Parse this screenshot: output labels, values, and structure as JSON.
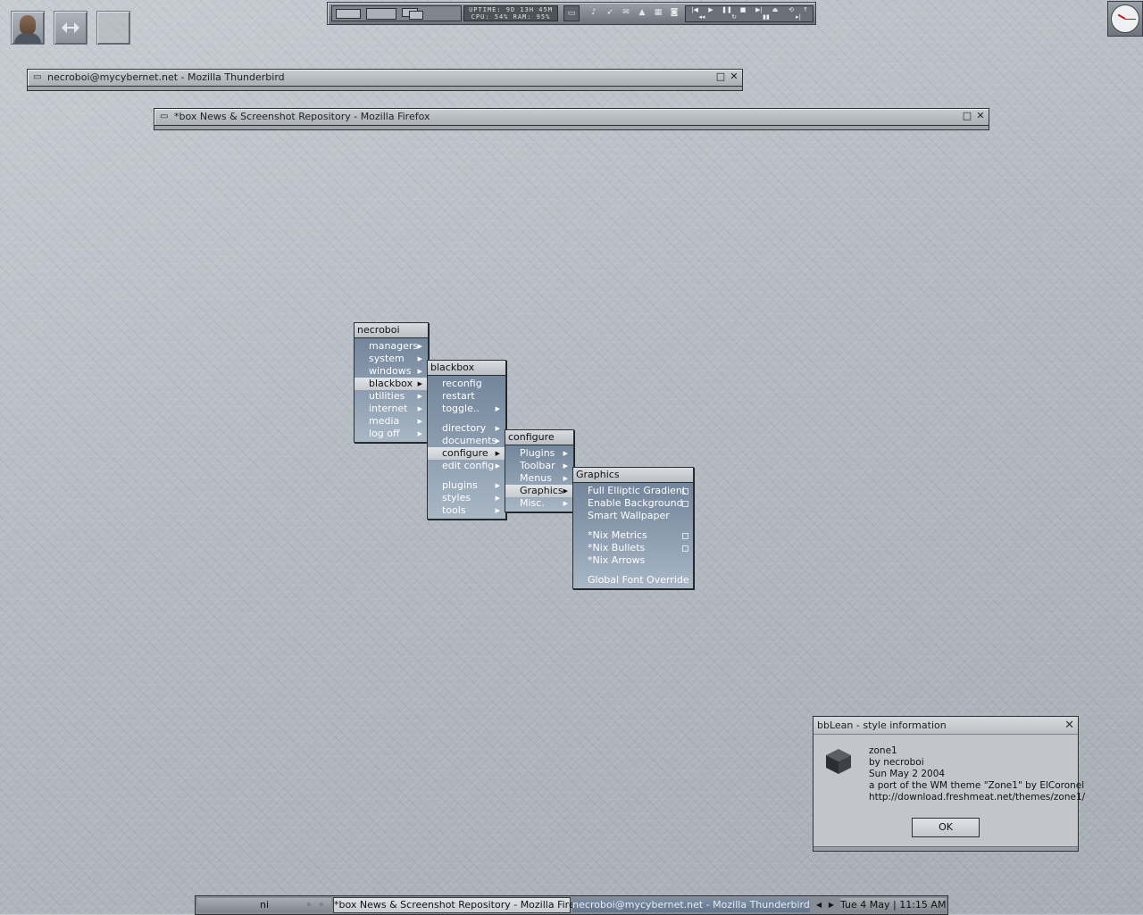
{
  "windows": {
    "thunderbird": {
      "title": "necroboi@mycybernet.net - Mozilla Thunderbird"
    },
    "firefox": {
      "title": "*box News & Screenshot Repository - Mozilla Firefox"
    }
  },
  "toolbar": {
    "sysinfo_line1": "UPTIME: 9D 13H 45M",
    "sysinfo_line2": "CPU: 54% RAM: 95%"
  },
  "menus": {
    "root": {
      "title": "necroboi",
      "items": [
        {
          "label": "managers"
        },
        {
          "label": "system"
        },
        {
          "label": "windows"
        },
        {
          "label": "blackbox"
        },
        {
          "label": "utilities"
        },
        {
          "label": "internet"
        },
        {
          "label": "media"
        },
        {
          "label": "log off"
        }
      ]
    },
    "blackbox": {
      "title": "blackbox",
      "items": [
        {
          "label": "reconfig"
        },
        {
          "label": "restart"
        },
        {
          "label": "toggle.."
        },
        {
          "label": "directory"
        },
        {
          "label": "documents"
        },
        {
          "label": "configure"
        },
        {
          "label": "edit config"
        },
        {
          "label": "plugins"
        },
        {
          "label": "styles"
        },
        {
          "label": "tools"
        }
      ]
    },
    "configure": {
      "title": "configure",
      "items": [
        {
          "label": "Plugins"
        },
        {
          "label": "Toolbar"
        },
        {
          "label": "Menus"
        },
        {
          "label": "Graphics"
        },
        {
          "label": "Misc."
        }
      ]
    },
    "graphics": {
      "title": "Graphics",
      "items": [
        {
          "label": "Full Elliptic Gradient"
        },
        {
          "label": "Enable Background"
        },
        {
          "label": "Smart Wallpaper"
        },
        {
          "label": "*Nix Metrics"
        },
        {
          "label": "*Nix Bullets"
        },
        {
          "label": "*Nix Arrows"
        },
        {
          "label": "Global Font Override"
        }
      ]
    }
  },
  "dialog": {
    "title": "bbLean - style information",
    "lines": [
      "zone1",
      "by necroboi",
      "Sun May 2 2004",
      "a port of the WM theme \"Zone1\" by ElCoronel",
      "http://download.freshmeat.net/themes/zone1/"
    ],
    "ok_label": "OK"
  },
  "taskbar": {
    "workspace": "ni",
    "tasks": [
      {
        "label": "*box News & Screenshot Repository - Mozilla Firefox"
      },
      {
        "label": "necroboi@mycybernet.net - Mozilla Thunderbird"
      }
    ],
    "clock": "Tue 4 May | 11:15 AM"
  }
}
